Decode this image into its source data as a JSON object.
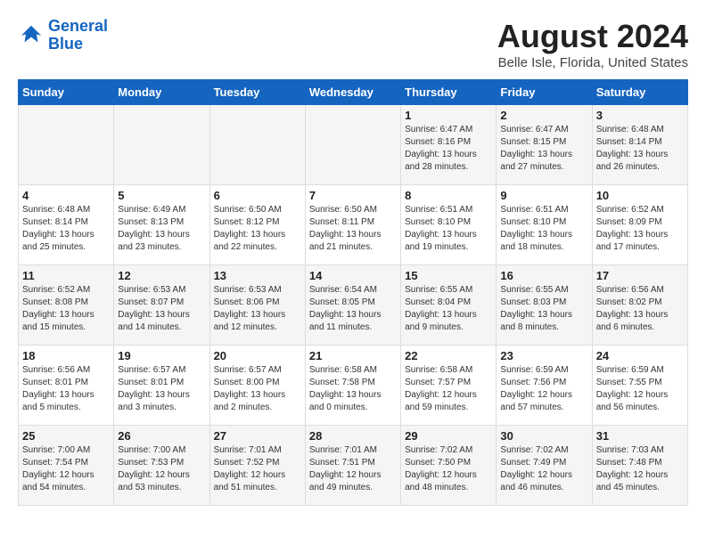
{
  "header": {
    "logo_line1": "General",
    "logo_line2": "Blue",
    "main_title": "August 2024",
    "subtitle": "Belle Isle, Florida, United States"
  },
  "weekdays": [
    "Sunday",
    "Monday",
    "Tuesday",
    "Wednesday",
    "Thursday",
    "Friday",
    "Saturday"
  ],
  "weeks": [
    [
      {
        "day": "",
        "info": ""
      },
      {
        "day": "",
        "info": ""
      },
      {
        "day": "",
        "info": ""
      },
      {
        "day": "",
        "info": ""
      },
      {
        "day": "1",
        "info": "Sunrise: 6:47 AM\nSunset: 8:16 PM\nDaylight: 13 hours\nand 28 minutes."
      },
      {
        "day": "2",
        "info": "Sunrise: 6:47 AM\nSunset: 8:15 PM\nDaylight: 13 hours\nand 27 minutes."
      },
      {
        "day": "3",
        "info": "Sunrise: 6:48 AM\nSunset: 8:14 PM\nDaylight: 13 hours\nand 26 minutes."
      }
    ],
    [
      {
        "day": "4",
        "info": "Sunrise: 6:48 AM\nSunset: 8:14 PM\nDaylight: 13 hours\nand 25 minutes."
      },
      {
        "day": "5",
        "info": "Sunrise: 6:49 AM\nSunset: 8:13 PM\nDaylight: 13 hours\nand 23 minutes."
      },
      {
        "day": "6",
        "info": "Sunrise: 6:50 AM\nSunset: 8:12 PM\nDaylight: 13 hours\nand 22 minutes."
      },
      {
        "day": "7",
        "info": "Sunrise: 6:50 AM\nSunset: 8:11 PM\nDaylight: 13 hours\nand 21 minutes."
      },
      {
        "day": "8",
        "info": "Sunrise: 6:51 AM\nSunset: 8:10 PM\nDaylight: 13 hours\nand 19 minutes."
      },
      {
        "day": "9",
        "info": "Sunrise: 6:51 AM\nSunset: 8:10 PM\nDaylight: 13 hours\nand 18 minutes."
      },
      {
        "day": "10",
        "info": "Sunrise: 6:52 AM\nSunset: 8:09 PM\nDaylight: 13 hours\nand 17 minutes."
      }
    ],
    [
      {
        "day": "11",
        "info": "Sunrise: 6:52 AM\nSunset: 8:08 PM\nDaylight: 13 hours\nand 15 minutes."
      },
      {
        "day": "12",
        "info": "Sunrise: 6:53 AM\nSunset: 8:07 PM\nDaylight: 13 hours\nand 14 minutes."
      },
      {
        "day": "13",
        "info": "Sunrise: 6:53 AM\nSunset: 8:06 PM\nDaylight: 13 hours\nand 12 minutes."
      },
      {
        "day": "14",
        "info": "Sunrise: 6:54 AM\nSunset: 8:05 PM\nDaylight: 13 hours\nand 11 minutes."
      },
      {
        "day": "15",
        "info": "Sunrise: 6:55 AM\nSunset: 8:04 PM\nDaylight: 13 hours\nand 9 minutes."
      },
      {
        "day": "16",
        "info": "Sunrise: 6:55 AM\nSunset: 8:03 PM\nDaylight: 13 hours\nand 8 minutes."
      },
      {
        "day": "17",
        "info": "Sunrise: 6:56 AM\nSunset: 8:02 PM\nDaylight: 13 hours\nand 6 minutes."
      }
    ],
    [
      {
        "day": "18",
        "info": "Sunrise: 6:56 AM\nSunset: 8:01 PM\nDaylight: 13 hours\nand 5 minutes."
      },
      {
        "day": "19",
        "info": "Sunrise: 6:57 AM\nSunset: 8:01 PM\nDaylight: 13 hours\nand 3 minutes."
      },
      {
        "day": "20",
        "info": "Sunrise: 6:57 AM\nSunset: 8:00 PM\nDaylight: 13 hours\nand 2 minutes."
      },
      {
        "day": "21",
        "info": "Sunrise: 6:58 AM\nSunset: 7:58 PM\nDaylight: 13 hours\nand 0 minutes."
      },
      {
        "day": "22",
        "info": "Sunrise: 6:58 AM\nSunset: 7:57 PM\nDaylight: 12 hours\nand 59 minutes."
      },
      {
        "day": "23",
        "info": "Sunrise: 6:59 AM\nSunset: 7:56 PM\nDaylight: 12 hours\nand 57 minutes."
      },
      {
        "day": "24",
        "info": "Sunrise: 6:59 AM\nSunset: 7:55 PM\nDaylight: 12 hours\nand 56 minutes."
      }
    ],
    [
      {
        "day": "25",
        "info": "Sunrise: 7:00 AM\nSunset: 7:54 PM\nDaylight: 12 hours\nand 54 minutes."
      },
      {
        "day": "26",
        "info": "Sunrise: 7:00 AM\nSunset: 7:53 PM\nDaylight: 12 hours\nand 53 minutes."
      },
      {
        "day": "27",
        "info": "Sunrise: 7:01 AM\nSunset: 7:52 PM\nDaylight: 12 hours\nand 51 minutes."
      },
      {
        "day": "28",
        "info": "Sunrise: 7:01 AM\nSunset: 7:51 PM\nDaylight: 12 hours\nand 49 minutes."
      },
      {
        "day": "29",
        "info": "Sunrise: 7:02 AM\nSunset: 7:50 PM\nDaylight: 12 hours\nand 48 minutes."
      },
      {
        "day": "30",
        "info": "Sunrise: 7:02 AM\nSunset: 7:49 PM\nDaylight: 12 hours\nand 46 minutes."
      },
      {
        "day": "31",
        "info": "Sunrise: 7:03 AM\nSunset: 7:48 PM\nDaylight: 12 hours\nand 45 minutes."
      }
    ]
  ]
}
